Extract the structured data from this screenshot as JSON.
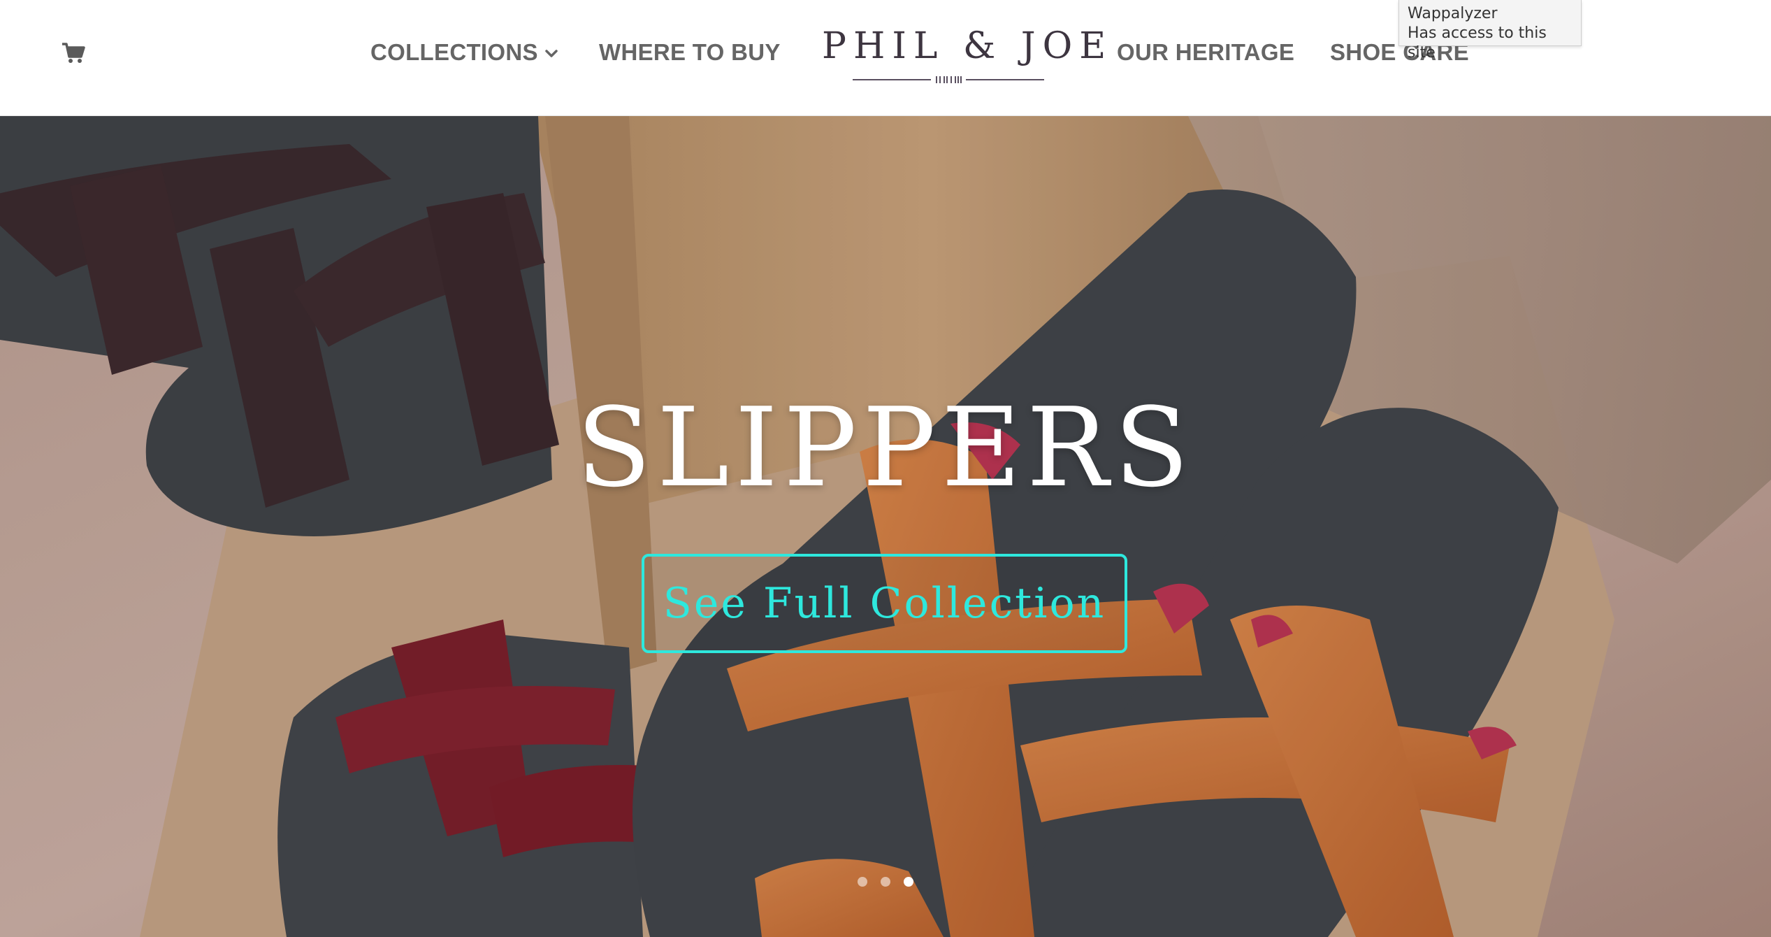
{
  "header": {
    "cart_icon": "shopping-cart-icon",
    "nav": {
      "collections": "COLLECTIONS",
      "collections_icon": "chevron-down-icon",
      "where_to_buy": "WHERE TO BUY",
      "our_heritage": "OUR HERITAGE",
      "shoe_care": "SHOE CARE"
    },
    "logo": {
      "text": "PHIL & JOE"
    }
  },
  "extension_tooltip": {
    "title": "Wappalyzer",
    "message": "Has access to this site"
  },
  "hero": {
    "title": "SLIPPERS",
    "button_label": "See Full Collection",
    "slider": {
      "total": 3,
      "active": 3
    }
  },
  "colors": {
    "nav_text": "#656565",
    "accent": "#2ee8dd",
    "logo": "#3d3540"
  }
}
